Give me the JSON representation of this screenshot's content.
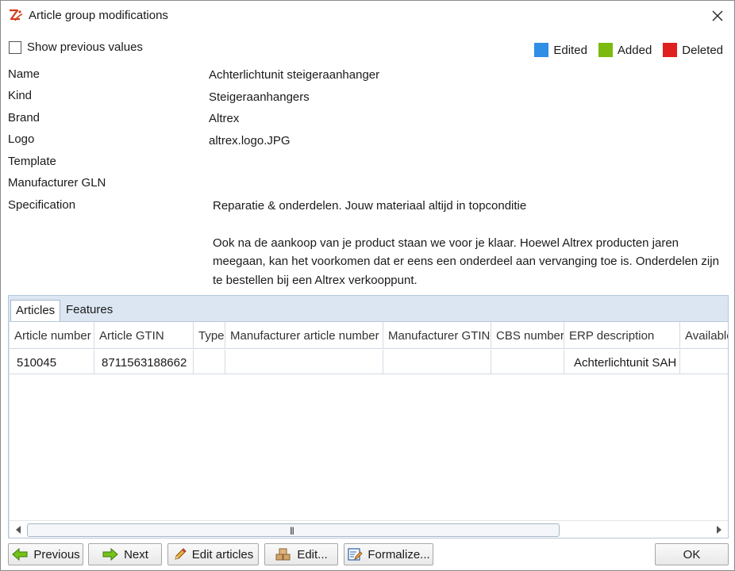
{
  "window": {
    "title": "Article group modifications"
  },
  "options": {
    "show_previous_label": "Show previous values"
  },
  "legend": [
    {
      "label": "Edited",
      "color": "#2f8ee6"
    },
    {
      "label": "Added",
      "color": "#7dba0f"
    },
    {
      "label": "Deleted",
      "color": "#e01f1f"
    }
  ],
  "fields": {
    "name": {
      "label": "Name",
      "value": "Achterlichtunit steigeraanhanger"
    },
    "kind": {
      "label": "Kind",
      "value": "Steigeraanhangers"
    },
    "brand": {
      "label": "Brand",
      "value": "Altrex"
    },
    "logo": {
      "label": "Logo",
      "value": "altrex.logo.JPG"
    },
    "template": {
      "label": "Template",
      "value": ""
    },
    "manufacturer_gln": {
      "label": "Manufacturer GLN",
      "value": ""
    },
    "specification": {
      "label": "Specification",
      "line1": "Reparatie & onderdelen. Jouw materiaal altijd in topconditie",
      "paragraph2": "Ook na de aankoop van je product staan we voor je klaar. Hoewel Altrex producten jaren meegaan, kan het voorkomen dat er eens een onderdeel aan vervanging toe is. Onderdelen zijn te bestellen bij een Altrex verkooppunt."
    }
  },
  "tabs": [
    {
      "label": "Articles"
    },
    {
      "label": "Features"
    }
  ],
  "table": {
    "columns": [
      "Article number",
      "Article GTIN",
      "Type",
      "Manufacturer article number",
      "Manufacturer GTIN",
      "CBS number",
      "ERP description",
      "Available"
    ],
    "rows": [
      [
        "510045",
        "8711563188662",
        "",
        "",
        "",
        "",
        "Achterlichtunit SAH",
        ""
      ]
    ]
  },
  "buttons": {
    "previous": "Previous",
    "next": "Next",
    "edit_articles": "Edit articles",
    "edit": "Edit...",
    "formalize": "Formalize...",
    "ok": "OK"
  }
}
